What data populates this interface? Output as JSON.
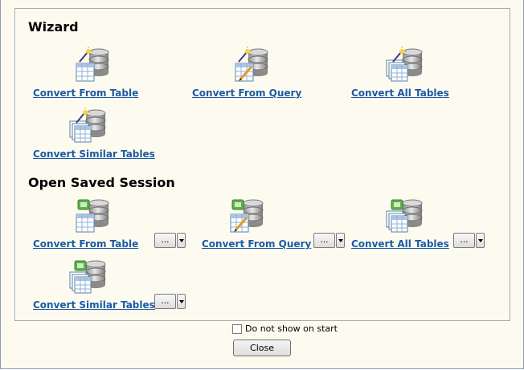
{
  "wizard": {
    "title": "Wizard",
    "items": [
      {
        "label": "Convert From Table",
        "icon": "table-db-wand-icon"
      },
      {
        "label": "Convert From Query",
        "icon": "query-db-wand-icon"
      },
      {
        "label": "Convert All Tables",
        "icon": "all-tables-db-wand-icon"
      },
      {
        "label": "Convert Similar Tables",
        "icon": "similar-tables-db-wand-icon"
      }
    ]
  },
  "saved": {
    "title": "Open Saved Session",
    "items": [
      {
        "label": "Convert From Table",
        "icon": "table-db-session-icon",
        "button": "..."
      },
      {
        "label": "Convert From Query",
        "icon": "query-db-session-icon",
        "button": "..."
      },
      {
        "label": "Convert All Tables",
        "icon": "all-tables-db-session-icon",
        "button": "..."
      },
      {
        "label": "Convert Similar Tables",
        "icon": "similar-tables-db-session-icon",
        "button": "..."
      }
    ]
  },
  "footer": {
    "checkbox_label": "Do not show on start",
    "checkbox_checked": false,
    "close_label": "Close"
  },
  "colors": {
    "background": "#fdfbf0",
    "link": "#1b5aa5"
  }
}
